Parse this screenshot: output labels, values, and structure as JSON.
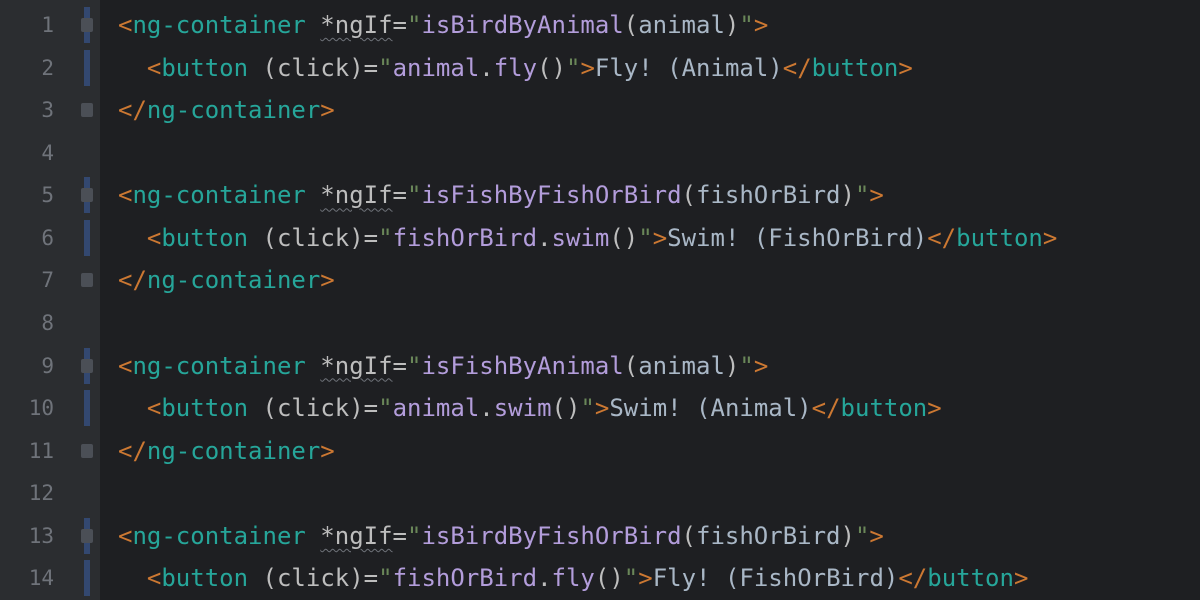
{
  "lineNumbers": [
    "1",
    "2",
    "3",
    "4",
    "5",
    "6",
    "7",
    "8",
    "9",
    "10",
    "11",
    "12",
    "13",
    "14"
  ],
  "fold": {
    "bars": [
      true,
      true,
      false,
      false,
      true,
      true,
      false,
      false,
      true,
      true,
      false,
      false,
      true,
      true
    ],
    "glyphs": [
      true,
      false,
      true,
      false,
      true,
      false,
      true,
      false,
      true,
      false,
      true,
      false,
      true,
      false
    ]
  },
  "code": {
    "l1": {
      "tag": "ng-container",
      "attr": "*ngIf",
      "fn": "isBirdByAnimal",
      "arg": "animal"
    },
    "l2": {
      "tag": "button",
      "attr": "(click)",
      "obj": "animal",
      "meth": "fly",
      "text": "Fly! (Animal)"
    },
    "l3": {
      "tag": "ng-container"
    },
    "l5": {
      "tag": "ng-container",
      "attr": "*ngIf",
      "fn": "isFishByFishOrBird",
      "arg": "fishOrBird"
    },
    "l6": {
      "tag": "button",
      "attr": "(click)",
      "obj": "fishOrBird",
      "meth": "swim",
      "text": "Swim! (FishOrBird)"
    },
    "l7": {
      "tag": "ng-container"
    },
    "l9": {
      "tag": "ng-container",
      "attr": "*ngIf",
      "fn": "isFishByAnimal",
      "arg": "animal"
    },
    "l10": {
      "tag": "button",
      "attr": "(click)",
      "obj": "animal",
      "meth": "swim",
      "text": "Swim! (Animal)"
    },
    "l11": {
      "tag": "ng-container"
    },
    "l13": {
      "tag": "ng-container",
      "attr": "*ngIf",
      "fn": "isBirdByFishOrBird",
      "arg": "fishOrBird"
    },
    "l14": {
      "tag": "button",
      "attr": "(click)",
      "obj": "fishOrBird",
      "meth": "fly",
      "text": "Fly! (FishOrBird)"
    }
  }
}
